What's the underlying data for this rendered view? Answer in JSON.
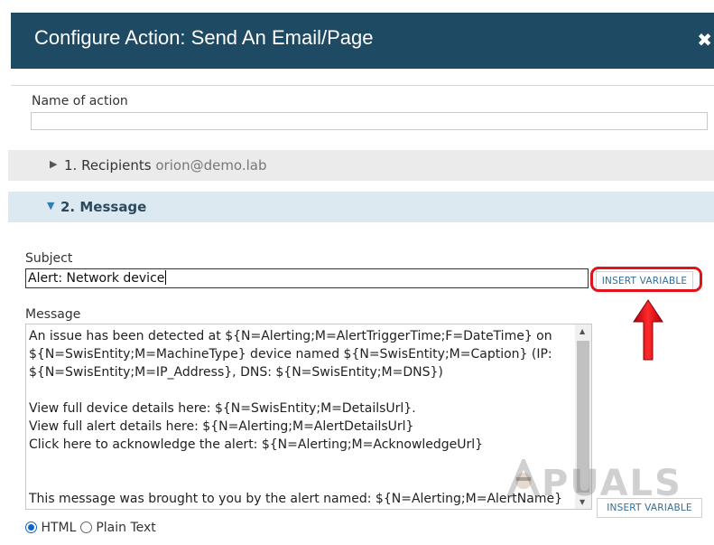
{
  "dialog": {
    "title": "Configure Action: Send An Email/Page",
    "close_glyph": "✖"
  },
  "name_of_action": {
    "label": "Name of action",
    "value": ""
  },
  "sections": {
    "recipients": {
      "label": "1. Recipients",
      "summary": "orion@demo.lab",
      "arrow": "▶"
    },
    "message": {
      "label": "2. Message",
      "arrow": "▼"
    }
  },
  "subject": {
    "label": "Subject",
    "value": "Alert: Network device"
  },
  "insert_variable_label": "INSERT VARIABLE",
  "message": {
    "label": "Message",
    "body": "An issue has been detected at ${N=Alerting;M=AlertTriggerTime;F=DateTime} on\n${N=SwisEntity;M=MachineType} device named ${N=SwisEntity;M=Caption} (IP:\n${N=SwisEntity;M=IP_Address}, DNS: ${N=SwisEntity;M=DNS})\n\nView full device details here: ${N=SwisEntity;M=DetailsUrl}.\nView full alert details here: ${N=Alerting;M=AlertDetailsUrl}\nClick here to acknowledge the alert: ${N=Alerting;M=AcknowledgeUrl}\n\n\nThis message was brought to you by the alert named: ${N=Alerting;M=AlertName}"
  },
  "format": {
    "options": [
      "HTML",
      "Plain Text"
    ],
    "selected": "HTML"
  },
  "watermark": {
    "text": "PUALS",
    "lead": "A"
  },
  "colors": {
    "title_bar": "#1f4a63",
    "highlight": "#e0121b",
    "link": "#2f6f9a"
  }
}
